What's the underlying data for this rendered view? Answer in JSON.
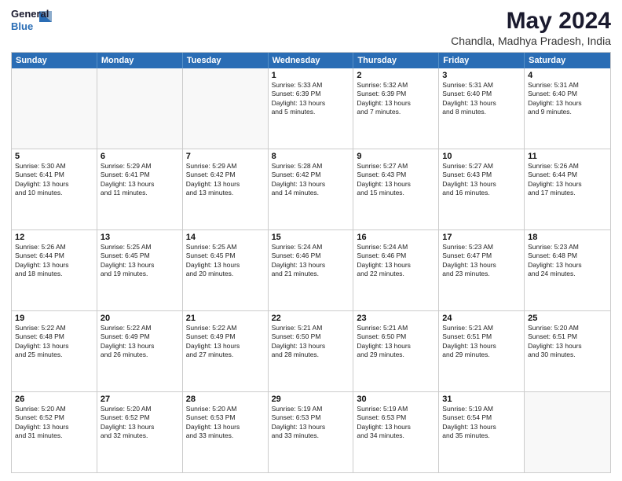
{
  "logo": {
    "general": "General",
    "blue": "Blue"
  },
  "title": "May 2024",
  "subtitle": "Chandla, Madhya Pradesh, India",
  "weekdays": [
    "Sunday",
    "Monday",
    "Tuesday",
    "Wednesday",
    "Thursday",
    "Friday",
    "Saturday"
  ],
  "weeks": [
    [
      {
        "day": "",
        "info": ""
      },
      {
        "day": "",
        "info": ""
      },
      {
        "day": "",
        "info": ""
      },
      {
        "day": "1",
        "info": "Sunrise: 5:33 AM\nSunset: 6:39 PM\nDaylight: 13 hours\nand 5 minutes."
      },
      {
        "day": "2",
        "info": "Sunrise: 5:32 AM\nSunset: 6:39 PM\nDaylight: 13 hours\nand 7 minutes."
      },
      {
        "day": "3",
        "info": "Sunrise: 5:31 AM\nSunset: 6:40 PM\nDaylight: 13 hours\nand 8 minutes."
      },
      {
        "day": "4",
        "info": "Sunrise: 5:31 AM\nSunset: 6:40 PM\nDaylight: 13 hours\nand 9 minutes."
      }
    ],
    [
      {
        "day": "5",
        "info": "Sunrise: 5:30 AM\nSunset: 6:41 PM\nDaylight: 13 hours\nand 10 minutes."
      },
      {
        "day": "6",
        "info": "Sunrise: 5:29 AM\nSunset: 6:41 PM\nDaylight: 13 hours\nand 11 minutes."
      },
      {
        "day": "7",
        "info": "Sunrise: 5:29 AM\nSunset: 6:42 PM\nDaylight: 13 hours\nand 13 minutes."
      },
      {
        "day": "8",
        "info": "Sunrise: 5:28 AM\nSunset: 6:42 PM\nDaylight: 13 hours\nand 14 minutes."
      },
      {
        "day": "9",
        "info": "Sunrise: 5:27 AM\nSunset: 6:43 PM\nDaylight: 13 hours\nand 15 minutes."
      },
      {
        "day": "10",
        "info": "Sunrise: 5:27 AM\nSunset: 6:43 PM\nDaylight: 13 hours\nand 16 minutes."
      },
      {
        "day": "11",
        "info": "Sunrise: 5:26 AM\nSunset: 6:44 PM\nDaylight: 13 hours\nand 17 minutes."
      }
    ],
    [
      {
        "day": "12",
        "info": "Sunrise: 5:26 AM\nSunset: 6:44 PM\nDaylight: 13 hours\nand 18 minutes."
      },
      {
        "day": "13",
        "info": "Sunrise: 5:25 AM\nSunset: 6:45 PM\nDaylight: 13 hours\nand 19 minutes."
      },
      {
        "day": "14",
        "info": "Sunrise: 5:25 AM\nSunset: 6:45 PM\nDaylight: 13 hours\nand 20 minutes."
      },
      {
        "day": "15",
        "info": "Sunrise: 5:24 AM\nSunset: 6:46 PM\nDaylight: 13 hours\nand 21 minutes."
      },
      {
        "day": "16",
        "info": "Sunrise: 5:24 AM\nSunset: 6:46 PM\nDaylight: 13 hours\nand 22 minutes."
      },
      {
        "day": "17",
        "info": "Sunrise: 5:23 AM\nSunset: 6:47 PM\nDaylight: 13 hours\nand 23 minutes."
      },
      {
        "day": "18",
        "info": "Sunrise: 5:23 AM\nSunset: 6:48 PM\nDaylight: 13 hours\nand 24 minutes."
      }
    ],
    [
      {
        "day": "19",
        "info": "Sunrise: 5:22 AM\nSunset: 6:48 PM\nDaylight: 13 hours\nand 25 minutes."
      },
      {
        "day": "20",
        "info": "Sunrise: 5:22 AM\nSunset: 6:49 PM\nDaylight: 13 hours\nand 26 minutes."
      },
      {
        "day": "21",
        "info": "Sunrise: 5:22 AM\nSunset: 6:49 PM\nDaylight: 13 hours\nand 27 minutes."
      },
      {
        "day": "22",
        "info": "Sunrise: 5:21 AM\nSunset: 6:50 PM\nDaylight: 13 hours\nand 28 minutes."
      },
      {
        "day": "23",
        "info": "Sunrise: 5:21 AM\nSunset: 6:50 PM\nDaylight: 13 hours\nand 29 minutes."
      },
      {
        "day": "24",
        "info": "Sunrise: 5:21 AM\nSunset: 6:51 PM\nDaylight: 13 hours\nand 29 minutes."
      },
      {
        "day": "25",
        "info": "Sunrise: 5:20 AM\nSunset: 6:51 PM\nDaylight: 13 hours\nand 30 minutes."
      }
    ],
    [
      {
        "day": "26",
        "info": "Sunrise: 5:20 AM\nSunset: 6:52 PM\nDaylight: 13 hours\nand 31 minutes."
      },
      {
        "day": "27",
        "info": "Sunrise: 5:20 AM\nSunset: 6:52 PM\nDaylight: 13 hours\nand 32 minutes."
      },
      {
        "day": "28",
        "info": "Sunrise: 5:20 AM\nSunset: 6:53 PM\nDaylight: 13 hours\nand 33 minutes."
      },
      {
        "day": "29",
        "info": "Sunrise: 5:19 AM\nSunset: 6:53 PM\nDaylight: 13 hours\nand 33 minutes."
      },
      {
        "day": "30",
        "info": "Sunrise: 5:19 AM\nSunset: 6:53 PM\nDaylight: 13 hours\nand 34 minutes."
      },
      {
        "day": "31",
        "info": "Sunrise: 5:19 AM\nSunset: 6:54 PM\nDaylight: 13 hours\nand 35 minutes."
      },
      {
        "day": "",
        "info": ""
      }
    ]
  ]
}
